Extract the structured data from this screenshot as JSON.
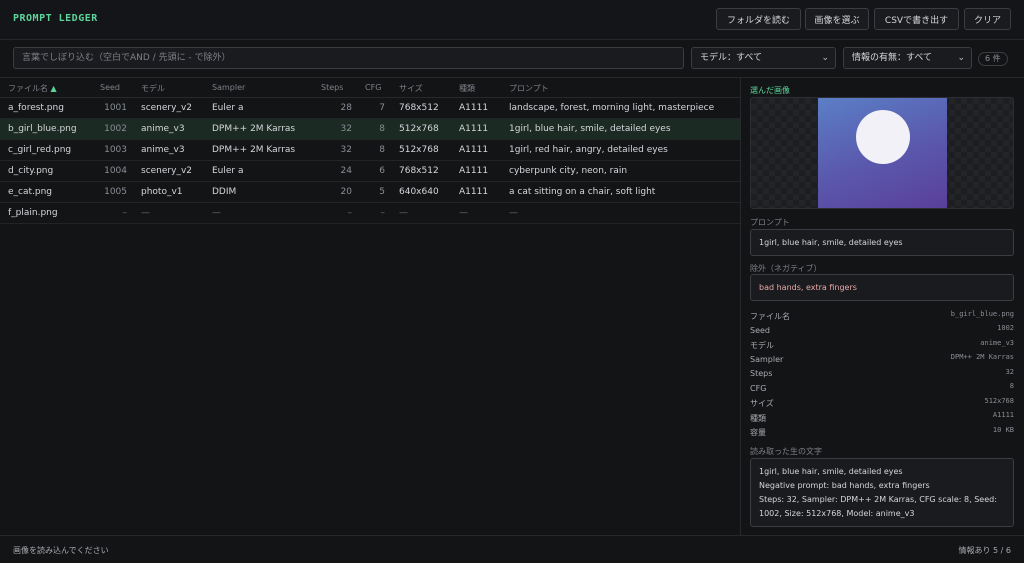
{
  "app": {
    "title": "PROMPT LEDGER"
  },
  "toolbar": {
    "load_folder": "フォルダを読む",
    "select_image": "画像を選ぶ",
    "export_csv": "CSVで書き出す",
    "clear": "クリア"
  },
  "filters": {
    "search_placeholder": "言葉でしぼり込む（空白でAND / 先頭に - で除外）",
    "model_select": "モデル：すべて",
    "info_select": "情報の有無：すべて",
    "count": "6 件"
  },
  "table": {
    "headers": {
      "file": "ファイル名",
      "seed": "Seed",
      "model": "モデル",
      "sampler": "Sampler",
      "steps": "Steps",
      "cfg": "CFG",
      "size": "サイズ",
      "kind": "種類",
      "prompt": "プロンプト"
    },
    "sort_indicator": "▲",
    "rows": [
      {
        "file": "a_forest.png",
        "seed": "1001",
        "model": "scenery_v2",
        "sampler": "Euler a",
        "steps": "28",
        "cfg": "7",
        "size": "768x512",
        "kind": "A1111",
        "prompt": "landscape, forest, morning light, masterpiece"
      },
      {
        "file": "b_girl_blue.png",
        "seed": "1002",
        "model": "anime_v3",
        "sampler": "DPM++ 2M Karras",
        "steps": "32",
        "cfg": "8",
        "size": "512x768",
        "kind": "A1111",
        "prompt": "1girl, blue hair, smile, detailed eyes"
      },
      {
        "file": "c_girl_red.png",
        "seed": "1003",
        "model": "anime_v3",
        "sampler": "DPM++ 2M Karras",
        "steps": "32",
        "cfg": "8",
        "size": "512x768",
        "kind": "A1111",
        "prompt": "1girl, red hair, angry, detailed eyes"
      },
      {
        "file": "d_city.png",
        "seed": "1004",
        "model": "scenery_v2",
        "sampler": "Euler a",
        "steps": "24",
        "cfg": "6",
        "size": "768x512",
        "kind": "A1111",
        "prompt": "cyberpunk city, neon, rain"
      },
      {
        "file": "e_cat.png",
        "seed": "1005",
        "model": "photo_v1",
        "sampler": "DDIM",
        "steps": "20",
        "cfg": "5",
        "size": "640x640",
        "kind": "A1111",
        "prompt": "a cat sitting on a chair, soft light"
      },
      {
        "file": "f_plain.png",
        "seed": "–",
        "model": "—",
        "sampler": "—",
        "steps": "–",
        "cfg": "–",
        "size": "—",
        "kind": "—",
        "prompt": "—"
      }
    ]
  },
  "detail": {
    "selected_label": "選んだ画像",
    "prompt_label": "プロンプト",
    "prompt": "1girl, blue hair, smile, detailed eyes",
    "negative_label": "除外（ネガティブ）",
    "negative": "bad hands, extra fingers",
    "meta": [
      {
        "key": "ファイル名",
        "value": "b_girl_blue.png"
      },
      {
        "key": "Seed",
        "value": "1002"
      },
      {
        "key": "モデル",
        "value": "anime_v3"
      },
      {
        "key": "Sampler",
        "value": "DPM++ 2M Karras"
      },
      {
        "key": "Steps",
        "value": "32"
      },
      {
        "key": "CFG",
        "value": "8"
      },
      {
        "key": "サイズ",
        "value": "512x768"
      },
      {
        "key": "種類",
        "value": "A1111"
      },
      {
        "key": "容量",
        "value": "10 KB"
      }
    ],
    "raw_label": "読み取った生の文字",
    "raw_lines": [
      "1girl, blue hair, smile, detailed eyes",
      "Negative prompt: bad hands, extra fingers",
      "Steps: 32, Sampler: DPM++ 2M Karras, CFG scale: 8, Seed:",
      "1002, Size: 512x768, Model: anime_v3"
    ]
  },
  "status": {
    "left": "画像を読み込んでください",
    "right": "情報あり 5 / 6"
  }
}
